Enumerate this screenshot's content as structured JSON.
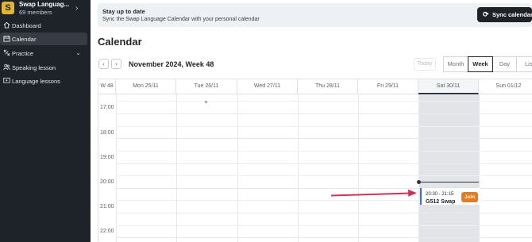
{
  "sidebar": {
    "org_initial": "S",
    "org_name": "Swap Languag...",
    "org_members": "69 members",
    "items": [
      {
        "label": "Dashboard",
        "icon": "home-icon"
      },
      {
        "label": "Calendar",
        "icon": "calendar-icon",
        "active": true
      },
      {
        "label": "Practice",
        "icon": "practice-icon",
        "expandable": true
      },
      {
        "label": "Speaking lesson",
        "icon": "people-icon"
      },
      {
        "label": "Language lessons",
        "icon": "video-icon"
      }
    ]
  },
  "banner": {
    "title": "Stay up to date",
    "subtitle": "Sync the Swap Language Calendar with your personal calendar",
    "button": "Sync calendar"
  },
  "page": {
    "title": "Calendar"
  },
  "toolbar": {
    "prev": "‹",
    "next": "›",
    "range_title": "November 2024, Week 48",
    "today": "Today",
    "views": [
      "Month",
      "Week",
      "Day",
      "Lis"
    ],
    "active_view": "Week"
  },
  "calendar": {
    "week_label": "W 48",
    "days": [
      "Mon 25/11",
      "Tue 26/11",
      "Wed 27/11",
      "Thu 28/11",
      "Fri 29/11",
      "Sat 30/11",
      "Sun 01/12"
    ],
    "times": [
      "17:00",
      "18:00",
      "19:00",
      "20:00",
      "21:00",
      "22:00"
    ],
    "event": {
      "time": "20:30 - 21:15",
      "title": "G512 Swap",
      "join": "Join"
    }
  },
  "colors": {
    "sidebar_bg": "#1e2229",
    "accent_orange": "#e07b27",
    "arrow": "#d1325a",
    "event_border": "#3b6fd8"
  }
}
